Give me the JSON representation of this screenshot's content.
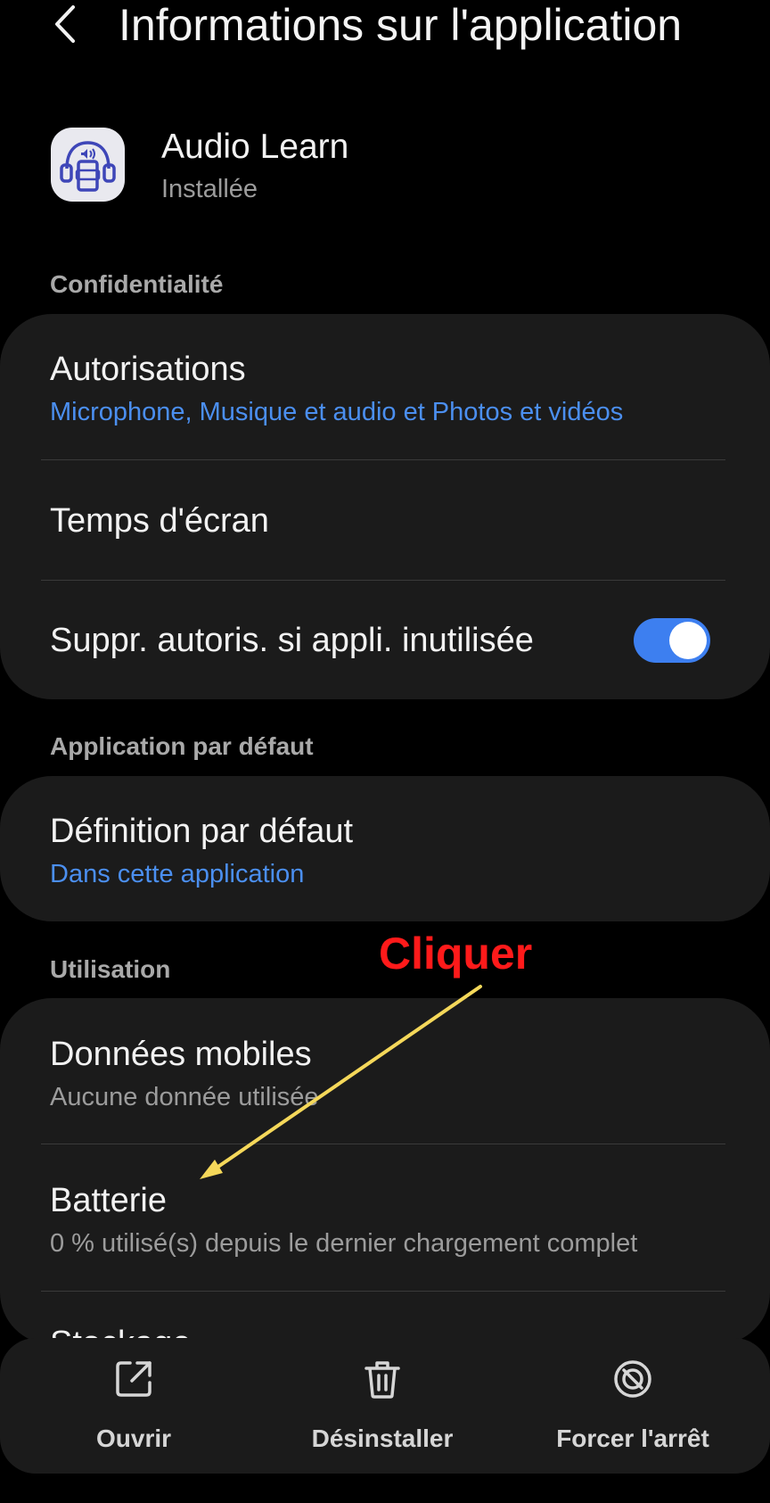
{
  "header": {
    "title": "Informations sur l'application",
    "back_icon": "chevron-left-icon"
  },
  "app": {
    "name": "Audio Learn",
    "status": "Installée",
    "icon": "headphones-phone-icon"
  },
  "sections": {
    "privacy": {
      "label": "Confidentialité",
      "permissions": {
        "title": "Autorisations",
        "subtitle": "Microphone, Musique et audio et Photos et vidéos"
      },
      "screen_time": {
        "title": "Temps d'écran"
      },
      "remove_permissions": {
        "title": "Suppr. autoris. si appli. inutilisée",
        "enabled": true
      }
    },
    "default_app": {
      "label": "Application par défaut",
      "set_default": {
        "title": "Définition par défaut",
        "subtitle": "Dans cette application"
      }
    },
    "usage": {
      "label": "Utilisation",
      "mobile_data": {
        "title": "Données mobiles",
        "subtitle": "Aucune donnée utilisée"
      },
      "battery": {
        "title": "Batterie",
        "subtitle": "0 % utilisé(s) depuis le dernier chargement complet"
      },
      "storage": {
        "title": "Stockage"
      }
    }
  },
  "annotation": {
    "text": "Cliquer",
    "text_color": "#ff1a1a",
    "arrow_color": "#f5d85a"
  },
  "bottom_actions": [
    {
      "label": "Ouvrir",
      "icon": "open-external-icon"
    },
    {
      "label": "Désinstaller",
      "icon": "trash-icon"
    },
    {
      "label": "Forcer l'arrêt",
      "icon": "force-stop-icon"
    }
  ],
  "colors": {
    "background": "#000000",
    "card": "#1b1b1b",
    "accent_blue": "#4b8ff0",
    "toggle_on": "#3d7ff0"
  }
}
